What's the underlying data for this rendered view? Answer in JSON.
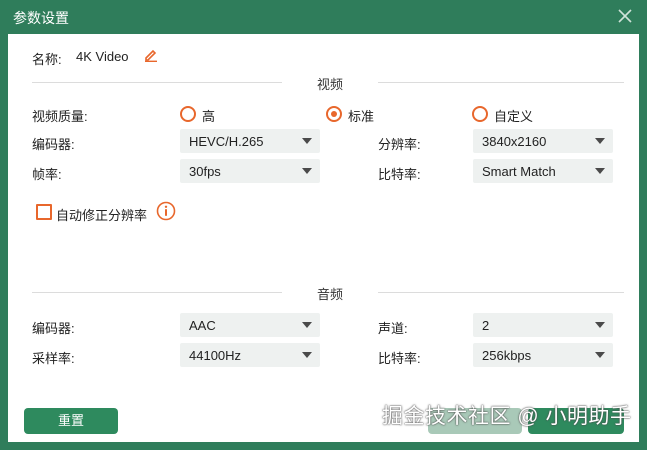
{
  "window": {
    "title": "参数设置"
  },
  "name": {
    "label": "名称:",
    "value": "4K Video"
  },
  "video": {
    "section_title": "视频",
    "quality_label": "视频质量:",
    "quality_options": [
      {
        "label": "高",
        "selected": false
      },
      {
        "label": "标准",
        "selected": true
      },
      {
        "label": "自定义",
        "selected": false
      }
    ],
    "encoder_label": "编码器:",
    "encoder_value": "HEVC/H.265",
    "resolution_label": "分辨率:",
    "resolution_value": "3840x2160",
    "framerate_label": "帧率:",
    "framerate_value": "30fps",
    "bitrate_label": "比特率:",
    "bitrate_value": "Smart Match",
    "auto_fix_label": "自动修正分辨率",
    "auto_fix_checked": false
  },
  "audio": {
    "section_title": "音频",
    "encoder_label": "编码器:",
    "encoder_value": "AAC",
    "channel_label": "声道:",
    "channel_value": "2",
    "samplerate_label": "采样率:",
    "samplerate_value": "44100Hz",
    "bitrate_label": "比特率:",
    "bitrate_value": "256kbps"
  },
  "footer": {
    "reset_label": "重置"
  },
  "watermark": {
    "text": "掘金技术社区 @ 小明助手"
  },
  "colors": {
    "titlebar": "#2f7d5b",
    "accent": "#e8672c",
    "button": "#2e8a5e"
  },
  "icons": {
    "close": "close-icon",
    "edit": "pencil-icon",
    "info": "info-icon"
  }
}
